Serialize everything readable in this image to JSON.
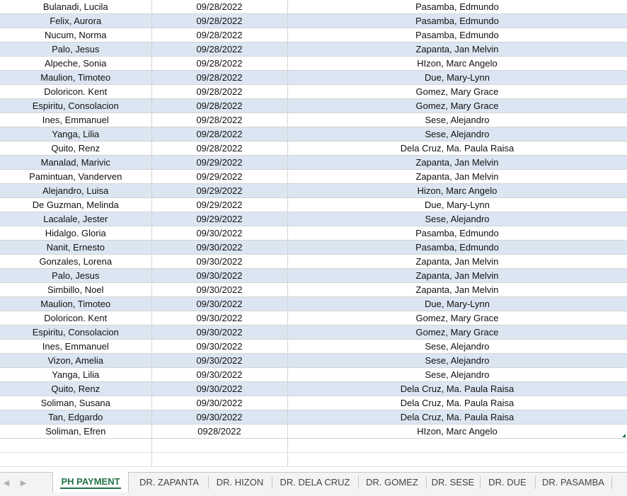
{
  "rows": [
    [
      "Bulanadi, Lucila",
      "09/28/2022",
      "Pasamba, Edmundo"
    ],
    [
      "Felix, Aurora",
      "09/28/2022",
      "Pasamba, Edmundo"
    ],
    [
      "Nucum, Norma",
      "09/28/2022",
      "Pasamba, Edmundo"
    ],
    [
      "Palo, Jesus",
      "09/28/2022",
      "Zapanta, Jan Melvin"
    ],
    [
      "Alpeche, Sonia",
      "09/28/2022",
      "HIzon, Marc Angelo"
    ],
    [
      "Maulion, Timoteo",
      "09/28/2022",
      "Due, Mary-Lynn"
    ],
    [
      "Doloricon. Kent",
      "09/28/2022",
      "Gomez, Mary Grace"
    ],
    [
      "Espiritu, Consolacion",
      "09/28/2022",
      "Gomez, Mary Grace"
    ],
    [
      "Ines, Emmanuel",
      "09/28/2022",
      "Sese, Alejandro"
    ],
    [
      "Yanga, Lilia",
      "09/28/2022",
      "Sese, Alejandro"
    ],
    [
      "Quito, Renz",
      "09/28/2022",
      "Dela Cruz, Ma. Paula Raisa"
    ],
    [
      "Manalad, Marivic",
      "09/29/2022",
      "Zapanta, Jan Melvin"
    ],
    [
      "Pamintuan, Vanderven",
      "09/29/2022",
      "Zapanta, Jan Melvin"
    ],
    [
      "Alejandro, Luisa",
      "09/29/2022",
      "Hizon, Marc Angelo"
    ],
    [
      "De Guzman, Melinda",
      "09/29/2022",
      "Due, Mary-Lynn"
    ],
    [
      "Lacalale, Jester",
      "09/29/2022",
      "Sese, Alejandro"
    ],
    [
      "Hidalgo. Gloria",
      "09/30/2022",
      "Pasamba, Edmundo"
    ],
    [
      "Nanit, Ernesto",
      "09/30/2022",
      "Pasamba, Edmundo"
    ],
    [
      "Gonzales, Lorena",
      "09/30/2022",
      "Zapanta, Jan Melvin"
    ],
    [
      "Palo, Jesus",
      "09/30/2022",
      "Zapanta, Jan Melvin"
    ],
    [
      "Simbillo, Noel",
      "09/30/2022",
      "Zapanta, Jan Melvin"
    ],
    [
      "Maulion, Timoteo",
      "09/30/2022",
      "Due, Mary-Lynn"
    ],
    [
      "Doloricon. Kent",
      "09/30/2022",
      "Gomez, Mary Grace"
    ],
    [
      "Espiritu, Consolacion",
      "09/30/2022",
      "Gomez, Mary Grace"
    ],
    [
      "Ines, Emmanuel",
      "09/30/2022",
      "Sese, Alejandro"
    ],
    [
      "Vizon, Amelia",
      "09/30/2022",
      "Sese, Alejandro"
    ],
    [
      "Yanga, Lilia",
      "09/30/2022",
      "Sese, Alejandro"
    ],
    [
      "Quito, Renz",
      "09/30/2022",
      "Dela Cruz, Ma. Paula Raisa"
    ],
    [
      "Soliman, Susana",
      "09/30/2022",
      "Dela Cruz, Ma. Paula Raisa"
    ],
    [
      "Tan, Edgardo",
      "09/30/2022",
      "Dela Cruz, Ma. Paula Raisa"
    ],
    [
      "Soliman, Efren",
      "0928/2022",
      "HIzon, Marc Angelo"
    ]
  ],
  "empty_rows": 2,
  "tabs": [
    {
      "label": "PH PAYMENT",
      "active": true
    },
    {
      "label": "DR. ZAPANTA",
      "active": false
    },
    {
      "label": "DR. HIZON",
      "active": false
    },
    {
      "label": "DR. DELA CRUZ",
      "active": false
    },
    {
      "label": "DR. GOMEZ",
      "active": false
    },
    {
      "label": "DR. SESE",
      "active": false
    },
    {
      "label": "DR. DUE",
      "active": false
    },
    {
      "label": "DR. PASAMBA",
      "active": false
    }
  ],
  "nav_arrows": {
    "prev": "◀",
    "next": "▶"
  },
  "colors": {
    "band": "#dce6f2",
    "active_tab_text": "#217346",
    "gridline": "#d4d4d4"
  }
}
